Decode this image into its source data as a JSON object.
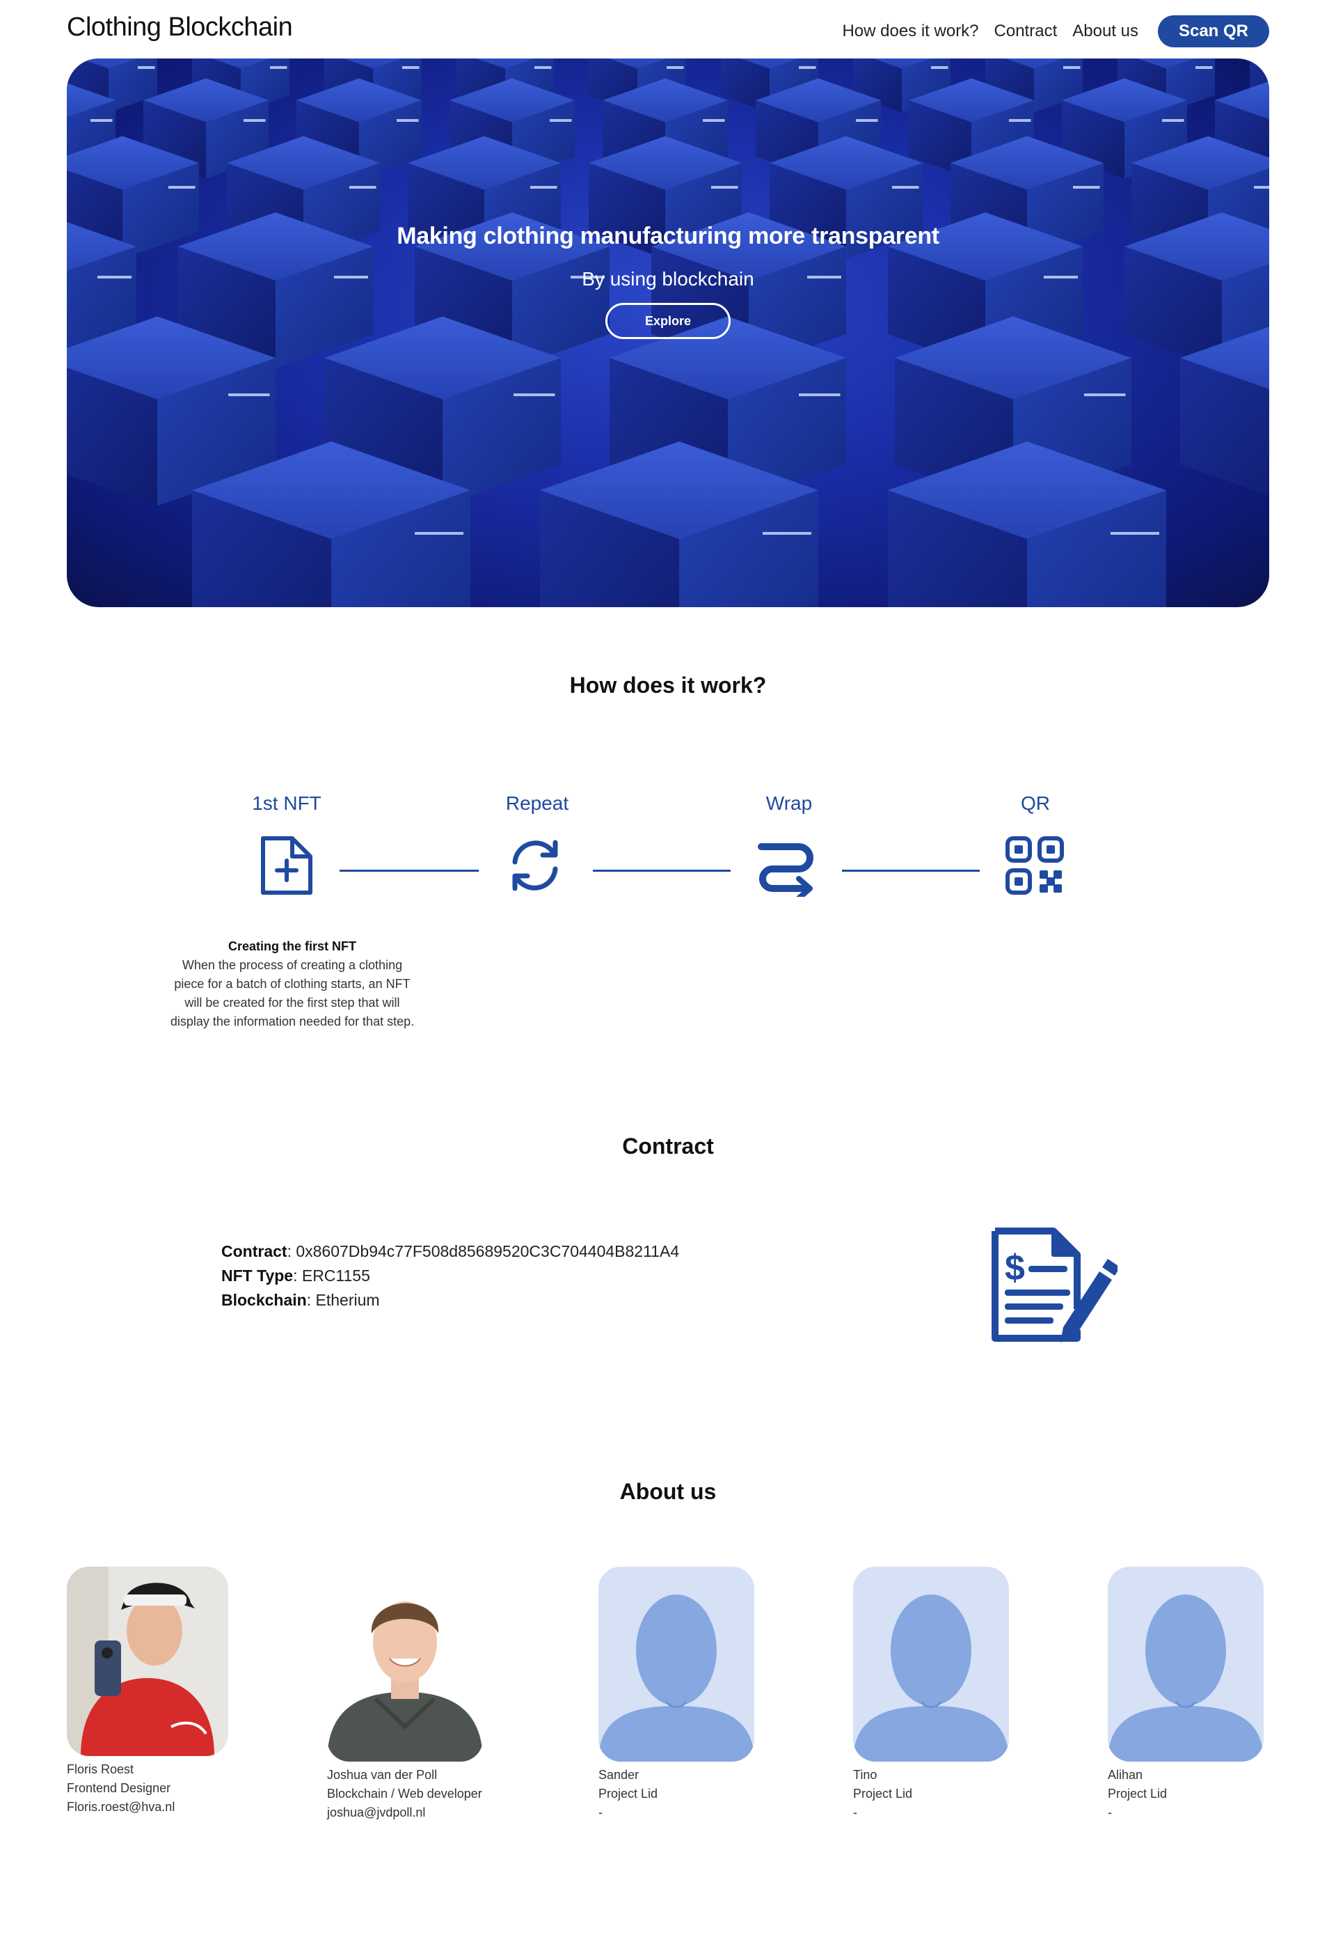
{
  "header": {
    "logo": "Clothing Blockchain",
    "nav": [
      {
        "label": "How does it work?"
      },
      {
        "label": "Contract"
      },
      {
        "label": "About us"
      }
    ],
    "scan_button": "Scan QR"
  },
  "hero": {
    "title": "Making clothing manufacturing more transparent",
    "subtitle": "By using blockchain",
    "button": "Explore"
  },
  "how": {
    "title": "How does it work?",
    "steps": [
      {
        "label": "1st NFT",
        "icon": "file-plus-icon"
      },
      {
        "label": "Repeat",
        "icon": "refresh-icon"
      },
      {
        "label": "Wrap",
        "icon": "wrap-arrow-icon"
      },
      {
        "label": "QR",
        "icon": "qr-code-icon"
      }
    ],
    "description": {
      "title": "Creating the first NFT",
      "text": "When the process of creating a clothing piece for a batch of clothing starts, an NFT will be created for the first step that will display the information needed for that step."
    }
  },
  "contract": {
    "title": "Contract",
    "contract_label": "Contract",
    "contract_value": ": 0x8607Db94c77F508d85689520C3C704404B8211A4",
    "nft_type_label": "NFT Type",
    "nft_type_value": ": ERC1155",
    "blockchain_label": "Blockchain",
    "blockchain_value": ": Etherium",
    "icon": "contract-sign-icon"
  },
  "about": {
    "title": "About us",
    "members": [
      {
        "name": "Floris Roest",
        "role": "Frontend Designer",
        "contact": "Floris.roest@hva.nl"
      },
      {
        "name": "Joshua van der Poll",
        "role": "Blockchain / Web developer",
        "contact": "joshua@jvdpoll.nl"
      },
      {
        "name": "Sander",
        "role": "Project Lid",
        "contact": "-"
      },
      {
        "name": "Tino",
        "role": "Project Lid",
        "contact": "-"
      },
      {
        "name": "Alihan",
        "role": "Project Lid",
        "contact": "-"
      }
    ]
  },
  "colors": {
    "accent": "#1f4aa0",
    "avatar_bg": "#d6e1f5",
    "avatar_fg": "#86a7e0"
  }
}
